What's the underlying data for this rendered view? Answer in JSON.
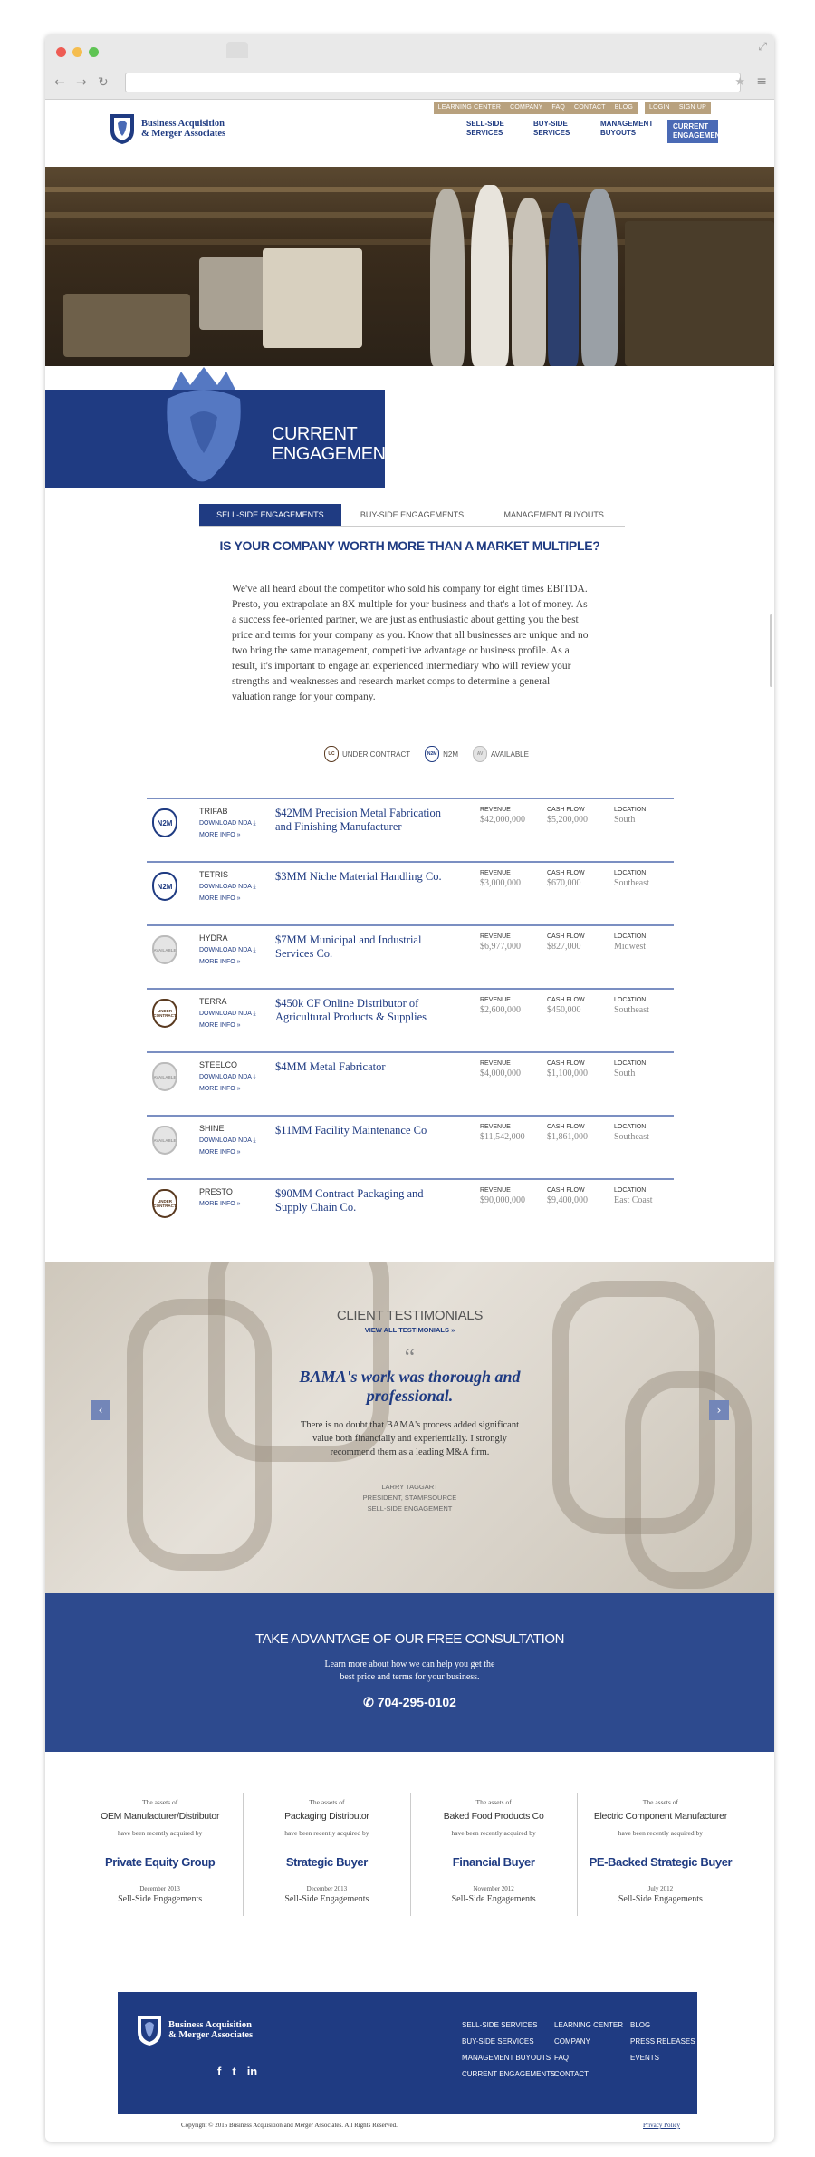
{
  "browser": {
    "url": ""
  },
  "header": {
    "logo_line1": "Business Acquisition",
    "logo_line2": "& Merger Associates",
    "util": [
      "Learning Center",
      "Company",
      "FAQ",
      "Contact",
      "Blog",
      "Login",
      "Sign Up"
    ],
    "nav": [
      "Sell-Side Services",
      "Buy-Side Services",
      "Management Buyouts",
      "Current Engagements"
    ]
  },
  "hero": {
    "title": "Current Engagements"
  },
  "tabs": [
    "Sell-Side Engagements",
    "Buy-Side Engagements",
    "Management Buyouts"
  ],
  "section_title": "Is your company worth more than a market multiple?",
  "intro": "We've all heard about the competitor who sold his company for eight times EBITDA. Presto, you extrapolate an 8X multiple for your business and that's a lot of money. As a success fee-oriented partner, we are just as enthusiastic about getting you the best price and terms for your company as you. Know that all businesses are unique and no two bring the same management, competitive advantage or business profile. As a result, it's important to engage an experienced intermediary who will review your strengths and weaknesses and research market comps to determine a general valuation range for your company.",
  "legend": [
    {
      "label": "Under Contract",
      "badge": "UNDER CONTRACT"
    },
    {
      "label": "N2M",
      "badge": "N2M"
    },
    {
      "label": "Available",
      "badge": "AVAILABLE"
    }
  ],
  "labels": {
    "download_nda": "Download NDA",
    "more_info": "More Info",
    "revenue": "Revenue",
    "cash_flow": "Cash Flow",
    "location": "Location"
  },
  "listings": [
    {
      "status": "N2M",
      "code": "Trifab",
      "title": "$42MM Precision Metal Fabrication and Finishing Manufacturer",
      "revenue": "$42,000,000",
      "cash_flow": "$5,200,000",
      "location": "South",
      "nda": true
    },
    {
      "status": "N2M",
      "code": "Tetris",
      "title": "$3MM Niche Material Handling Co.",
      "revenue": "$3,000,000",
      "cash_flow": "$670,000",
      "location": "Southeast",
      "nda": true
    },
    {
      "status": "AVAILABLE",
      "code": "Hydra",
      "title": "$7MM Municipal and Industrial Services Co.",
      "revenue": "$6,977,000",
      "cash_flow": "$827,000",
      "location": "Midwest",
      "nda": true
    },
    {
      "status": "UNDER CONTRACT",
      "code": "Terra",
      "title": "$450k CF Online Distributor of Agricultural Products & Supplies",
      "revenue": "$2,600,000",
      "cash_flow": "$450,000",
      "location": "Southeast",
      "nda": true
    },
    {
      "status": "AVAILABLE",
      "code": "Steelco",
      "title": "$4MM Metal Fabricator",
      "revenue": "$4,000,000",
      "cash_flow": "$1,100,000",
      "location": "South",
      "nda": true
    },
    {
      "status": "AVAILABLE",
      "code": "Shine",
      "title": "$11MM Facility Maintenance Co",
      "revenue": "$11,542,000",
      "cash_flow": "$1,861,000",
      "location": "Southeast",
      "nda": true
    },
    {
      "status": "UNDER CONTRACT",
      "code": "Presto",
      "title": "$90MM Contract Packaging and Supply Chain Co.",
      "revenue": "$90,000,000",
      "cash_flow": "$9,400,000",
      "location": "East Coast",
      "nda": false
    }
  ],
  "testimonials": {
    "title": "Client Testimonials",
    "link": "View All Testimonials",
    "quote_mark": "“",
    "headline": "BAMA's work was thorough and professional.",
    "body": "There is no doubt that BAMA's process added significant value both financially and experientially. I strongly recommend them as a leading M&A firm.",
    "author": "Larry Taggart",
    "role": "President, Stampsource",
    "engagement": "Sell-Side Engagement"
  },
  "cta": {
    "title": "Take advantage of our free consultation",
    "body": "Learn more about how we can help you get the best price and terms for your business.",
    "phone": "704-295-0102"
  },
  "deals": [
    {
      "pre": "The assets of",
      "company": "OEM Manufacturer/Distributor",
      "mid": "have been recently acquired by",
      "buyer": "Private Equity Group",
      "date": "December 2013",
      "type": "Sell-Side Engagements"
    },
    {
      "pre": "The assets of",
      "company": "Packaging Distributor",
      "mid": "have been recently acquired by",
      "buyer": "Strategic Buyer",
      "date": "December 2013",
      "type": "Sell-Side Engagements"
    },
    {
      "pre": "The assets of",
      "company": "Baked Food Products Co",
      "mid": "have been recently acquired by",
      "buyer": "Financial Buyer",
      "date": "November 2012",
      "type": "Sell-Side Engagements"
    },
    {
      "pre": "The assets of",
      "company": "Electric Component Manufacturer",
      "mid": "have been recently acquired by",
      "buyer": "PE-Backed Strategic Buyer",
      "date": "July 2012",
      "type": "Sell-Side Engagements"
    }
  ],
  "footer": {
    "col1": [
      "Sell-Side Services",
      "Buy-Side Services",
      "Management Buyouts",
      "Current Engagements"
    ],
    "col2": [
      "Learning Center",
      "Company",
      "FAQ",
      "Contact"
    ],
    "col3": [
      "Blog",
      "Press Releases",
      "Events"
    ],
    "social": [
      "f",
      "t",
      "in"
    ],
    "copyright": "Copyright © 2015 Business Acquisition and Merger Associates. All Rights Reserved.",
    "privacy": "Privacy Policy"
  },
  "colors": {
    "brand": "#1f3b82",
    "accent": "#b8a17e"
  }
}
